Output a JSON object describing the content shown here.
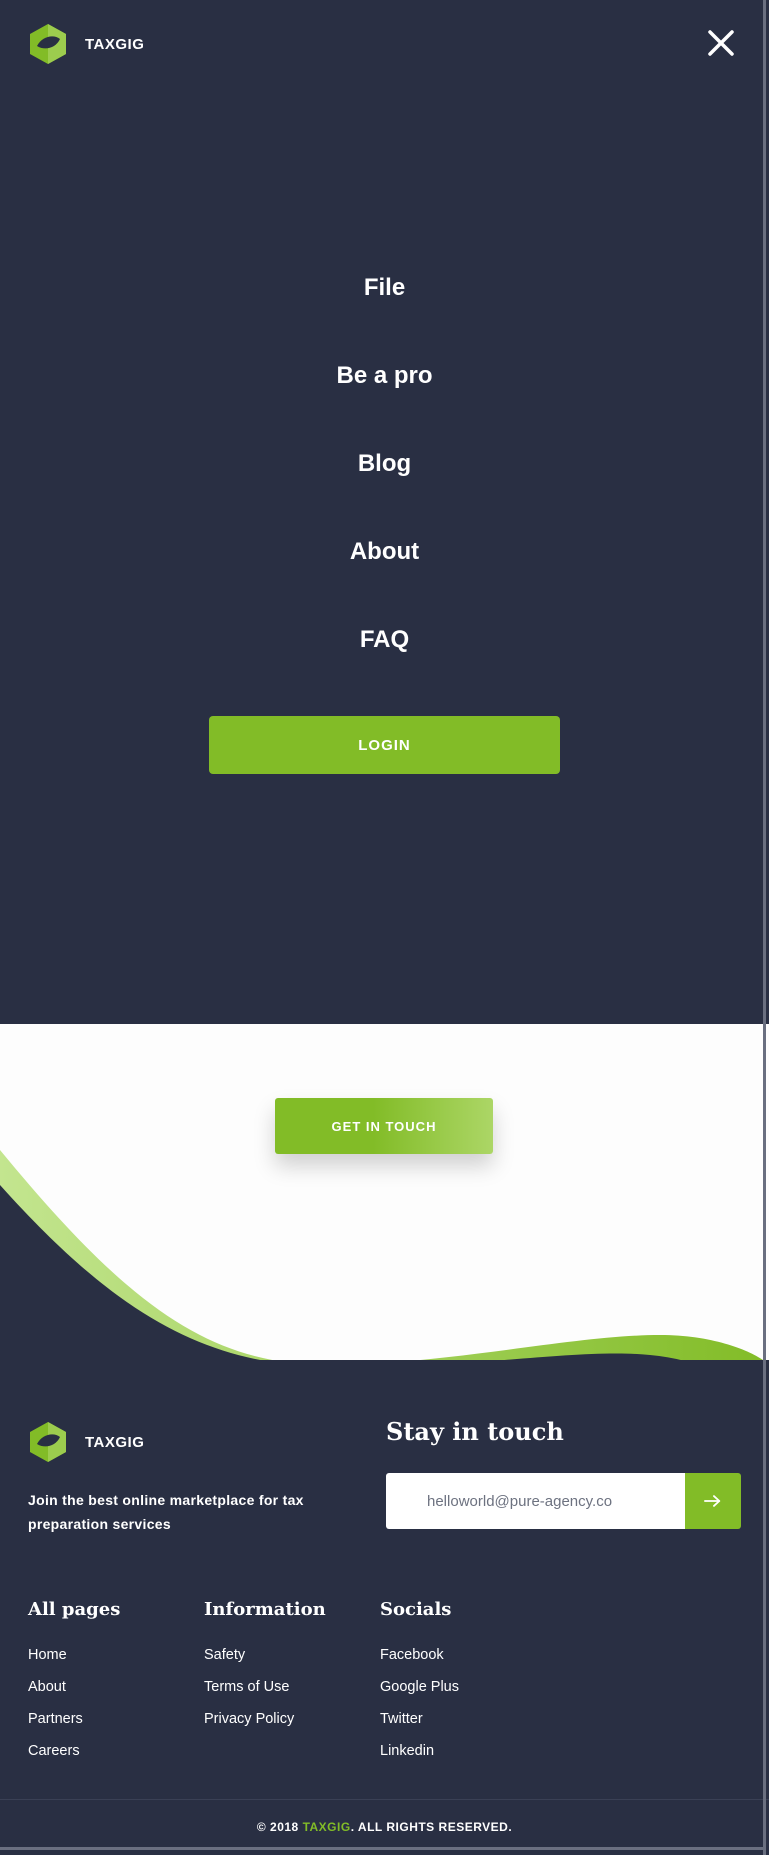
{
  "brand": {
    "name": "TAXGIG",
    "accent": "#82bc27",
    "dark_bg": "#292f43"
  },
  "menu": {
    "items": [
      "File",
      "Be a pro",
      "Blog",
      "About",
      "FAQ"
    ],
    "login_label": "LOGIN",
    "close_icon": "close-icon"
  },
  "cta": {
    "label": "GET IN TOUCH"
  },
  "footer": {
    "tagline": "Join the best online marketplace for tax preparation services",
    "stay_title": "Stay in touch",
    "email_placeholder": "helloworld@pure-agency.co",
    "submit_icon": "arrow-right-icon",
    "columns": [
      {
        "title": "All pages",
        "links": [
          "Home",
          "About",
          "Partners",
          "Careers"
        ]
      },
      {
        "title": "Information",
        "links": [
          "Safety",
          "Terms of Use",
          "Privacy Policy"
        ]
      },
      {
        "title": "Socials",
        "links": [
          "Facebook",
          "Google Plus",
          "Twitter",
          "Linkedin"
        ]
      }
    ],
    "copyright_prefix": "© 2018 ",
    "copyright_brand": "TAXGIG",
    "copyright_suffix": ". ALL RIGHTS RESERVED."
  }
}
